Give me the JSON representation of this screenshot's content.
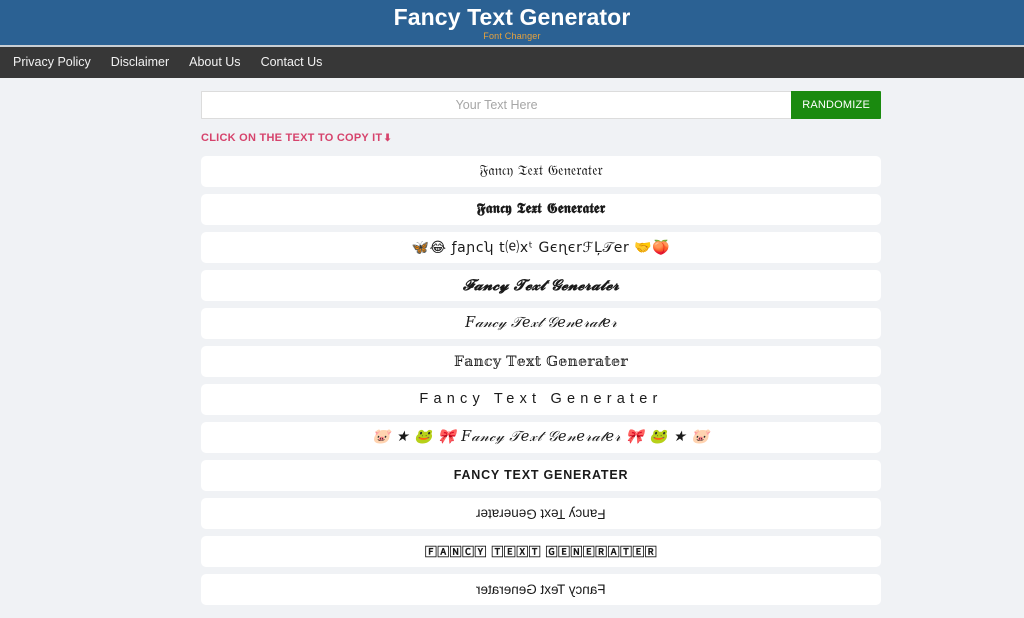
{
  "header": {
    "title": "Fancy Text Generator",
    "subtitle": "Font Changer",
    "bg_color": "#2b6193",
    "subtitle_color": "#e8a33d"
  },
  "nav": {
    "bg_color": "#373737",
    "items": [
      {
        "label": "Privacy Policy",
        "name": "nav-privacy-policy"
      },
      {
        "label": "Disclaimer",
        "name": "nav-disclaimer"
      },
      {
        "label": "About Us",
        "name": "nav-about-us"
      },
      {
        "label": "Contact Us",
        "name": "nav-contact-us"
      }
    ]
  },
  "search": {
    "placeholder": "Your Text Here",
    "value": "",
    "randomize_label": "RANDOMIZE",
    "randomize_color": "#1a8a0f"
  },
  "hint": {
    "text": "CLICK ON THE TEXT TO COPY IT",
    "arrow": "⬇",
    "color": "#d6436c"
  },
  "results": {
    "base_text": "Fancy Text Generater",
    "rows": [
      {
        "style": "s-fraktur",
        "name": "result-row-fraktur",
        "text": "𝔉𝔞𝔫𝔠𝔶 𝔗𝔢𝔵𝔱 𝔊𝔢𝔫𝔢𝔯𝔞𝔱𝔢𝔯"
      },
      {
        "style": "s-fraktur-bold",
        "name": "result-row-fraktur-bold",
        "text": "𝕱𝖆𝖓𝖈𝖞 𝕿𝖊𝖝𝖙 𝕲𝖊𝖓𝖊𝖗𝖆𝖙𝖊𝖗"
      },
      {
        "style": "s-emoji-mixed",
        "name": "result-row-emoji-mixed",
        "text": "🦋😂 ƒaɲcʮ t⒠xᵗ GєɳєrℱĻ𝒯er 🤝🍑"
      },
      {
        "style": "s-script-bold",
        "name": "result-row-script-bold",
        "text": "𝓕𝓪𝓷𝓬𝔂 𝓣𝓮𝔁𝓽 𝓖𝓮𝓷𝓮𝓻𝓪𝓽𝓮𝓻"
      },
      {
        "style": "s-script",
        "name": "result-row-script",
        "text": "𝐹𝒶𝓃𝒸𝓎 𝒯𝑒𝓍𝓉 𝒢𝑒𝓃𝑒𝓇𝒶𝓉𝑒𝓇"
      },
      {
        "style": "s-doublestruck",
        "name": "result-row-double-struck",
        "text": "𝔽𝕒𝕟𝕔𝕪 𝕋𝕖𝕩𝕥 𝔾𝕖𝕟𝕖𝕣𝕒𝕥𝕖𝕣"
      },
      {
        "style": "s-spaced",
        "name": "result-row-spaced",
        "text": "Fancy Text Generater"
      },
      {
        "style": "s-deco-script",
        "name": "result-row-decorated-script",
        "text": "🐷 ★ 🐸 🎀 𝐹𝒶𝓃𝒸𝓎 𝒯𝑒𝓍𝓉 𝒢𝑒𝓃𝑒𝓇𝒶𝓉𝑒𝓇 🎀 🐸 ★ 🐷"
      },
      {
        "style": "s-smallcaps",
        "name": "result-row-small-caps",
        "text": "FANCY TEXT GENERATER"
      },
      {
        "style": "s-upsidedown",
        "name": "result-row-upside-down",
        "text": "Fancy Text Generater"
      },
      {
        "style": "s-squared",
        "name": "result-row-squared",
        "text": "🄵🄰🄽🄲🅈 🅃🄴🅇🅃 🄶🄴🄽🄴🅁🄰🅃🄴🅁"
      },
      {
        "style": "s-mirrored",
        "name": "result-row-mirrored",
        "text": "Fancy Text Generater"
      }
    ]
  },
  "page": {
    "bg_color": "#f0f2f5",
    "card_color": "#ffffff"
  }
}
